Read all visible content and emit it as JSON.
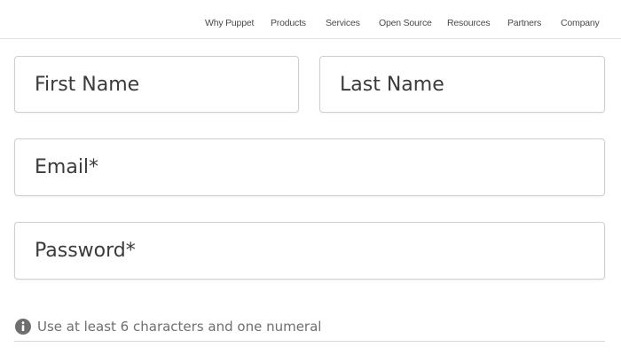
{
  "nav": {
    "items": [
      "Why Puppet",
      "Products",
      "Services",
      "Open Source",
      "Resources",
      "Partners",
      "Company"
    ]
  },
  "form": {
    "first_name_placeholder": "First Name",
    "last_name_placeholder": "Last Name",
    "email_placeholder": "Email*",
    "password_placeholder": "Password*",
    "password_hint": "Use at least 6 characters and one numeral",
    "hint_icon": "info-icon"
  },
  "colors": {
    "text": "#3b3b3b",
    "border": "#cfcfcf",
    "hint": "#6f6f6f"
  }
}
